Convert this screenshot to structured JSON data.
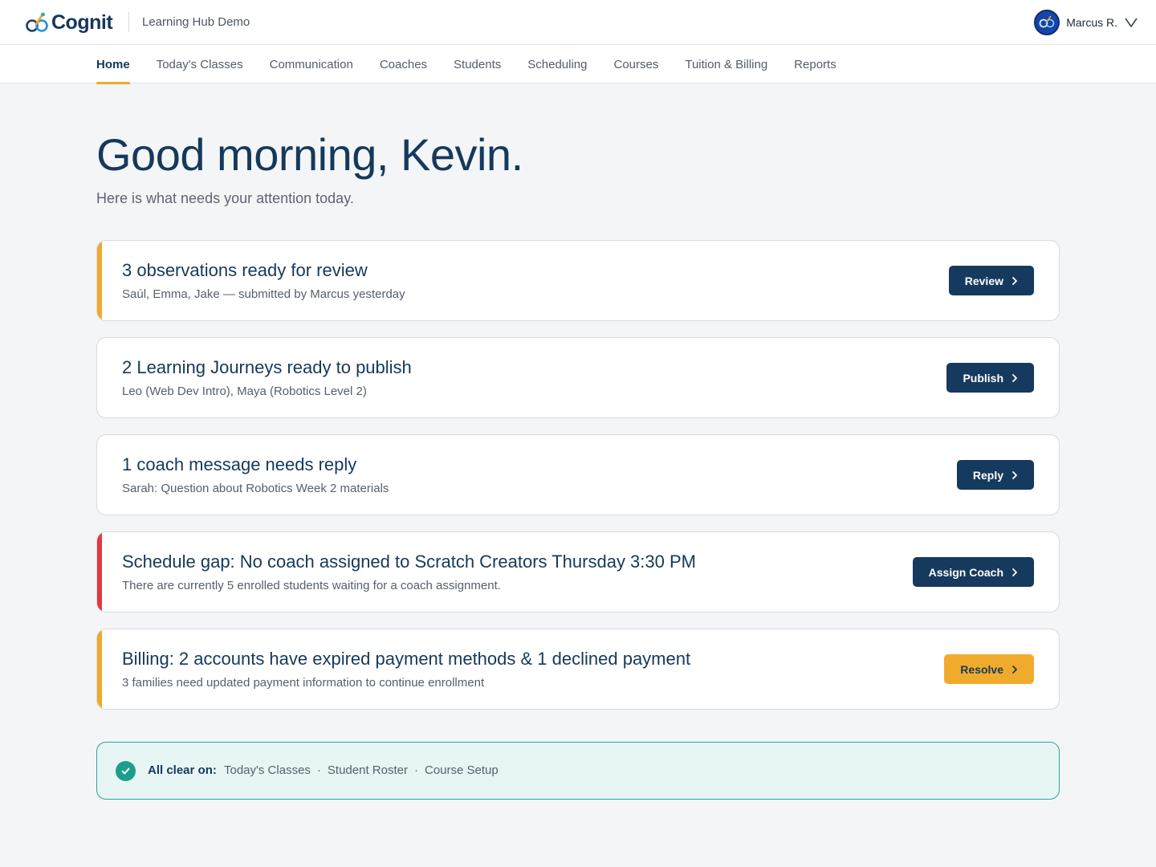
{
  "header": {
    "brand_name": "Cognit",
    "app_subtitle": "Learning Hub Demo",
    "user_name": "Marcus R.",
    "avatar_icon": "cognit-avatar-icon"
  },
  "nav": {
    "tabs": [
      {
        "label": "Home",
        "active": true
      },
      {
        "label": "Today's Classes",
        "active": false
      },
      {
        "label": "Communication",
        "active": false
      },
      {
        "label": "Coaches",
        "active": false
      },
      {
        "label": "Students",
        "active": false
      },
      {
        "label": "Scheduling",
        "active": false
      },
      {
        "label": "Courses",
        "active": false
      },
      {
        "label": "Tuition & Billing",
        "active": false
      },
      {
        "label": "Reports",
        "active": false
      }
    ]
  },
  "greeting": {
    "title": "Good morning, Kevin.",
    "subtitle": "Here is what needs your attention today."
  },
  "cards": [
    {
      "title": "3 observations ready for review",
      "description": "Saúl, Emma, Jake — submitted by Marcus yesterday",
      "button_label": "Review",
      "accent_color": "#f0a92a",
      "button_style": "primary"
    },
    {
      "title": "2 Learning Journeys ready to publish",
      "description": "Leo (Web Dev Intro), Maya (Robotics Level 2)",
      "button_label": "Publish",
      "accent_color": "",
      "button_style": "primary"
    },
    {
      "title": "1 coach message needs reply",
      "description": "Sarah: Question about Robotics Week 2 materials",
      "button_label": "Reply",
      "accent_color": "",
      "button_style": "primary"
    },
    {
      "title": "Schedule gap: No coach assigned to Scratch Creators Thursday 3:30 PM",
      "description": "There are currently 5 enrolled students waiting for a coach assignment.",
      "button_label": "Assign Coach",
      "accent_color": "#e0393e",
      "button_style": "primary"
    },
    {
      "title": "Billing: 2 accounts have expired payment methods & 1 declined payment",
      "description": "3 families need updated payment information to continue enrollment",
      "button_label": "Resolve",
      "accent_color": "#f0a92a",
      "button_style": "warning"
    }
  ],
  "all_clear": {
    "label": "All clear on:",
    "items": [
      "Today's Classes",
      "Student Roster",
      "Course Setup"
    ],
    "separator": "·"
  },
  "colors": {
    "primary": "#153a5d",
    "warning": "#f1ab2c",
    "danger": "#e0393e",
    "success": "#1c9e8c"
  }
}
